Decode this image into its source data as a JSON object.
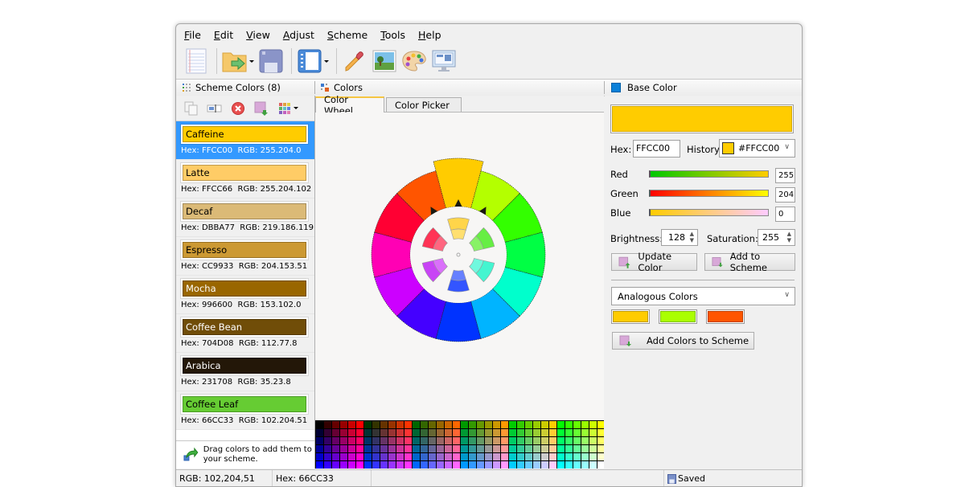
{
  "menu": {
    "items": [
      {
        "label": "File",
        "mnemonic": "F",
        "rest": "ile"
      },
      {
        "label": "Edit",
        "mnemonic": "E",
        "rest": "dit"
      },
      {
        "label": "View",
        "mnemonic": "V",
        "rest": "iew"
      },
      {
        "label": "Adjust",
        "mnemonic": "A",
        "rest": "djust"
      },
      {
        "label": "Scheme",
        "mnemonic": "S",
        "rest": "cheme"
      },
      {
        "label": "Tools",
        "mnemonic": "T",
        "rest": "ools"
      },
      {
        "label": "Help",
        "mnemonic": "H",
        "rest": "elp"
      }
    ]
  },
  "toolbar": {
    "buttons": [
      "new-document-icon",
      "open-folder-icon",
      "save-icon",
      "layout-panel-icon",
      "eyedropper-icon",
      "image-icon",
      "palette-icon",
      "screen-icon"
    ]
  },
  "panels": {
    "scheme_header": "Scheme Colors (8)",
    "colors_header": "Colors",
    "base_header": "Base Color"
  },
  "scheme": {
    "items": [
      {
        "name": "Caffeine",
        "hex": "FFCC00",
        "rgb": "255.204.0",
        "color": "#FFCC00",
        "text_color": "#000000",
        "selected": true
      },
      {
        "name": "Latte",
        "hex": "FFCC66",
        "rgb": "255.204.102",
        "color": "#FFCC66",
        "text_color": "#000000",
        "selected": false
      },
      {
        "name": "Decaf",
        "hex": "DBBA77",
        "rgb": "219.186.119",
        "color": "#DBBA77",
        "text_color": "#000000",
        "selected": false
      },
      {
        "name": "Espresso",
        "hex": "CC9933",
        "rgb": "204.153.51",
        "color": "#CC9933",
        "text_color": "#000000",
        "selected": false
      },
      {
        "name": "Mocha",
        "hex": "996600",
        "rgb": "153.102.0",
        "color": "#996600",
        "text_color": "#ffffff",
        "selected": false
      },
      {
        "name": "Coffee Bean",
        "hex": "704D08",
        "rgb": "112.77.8",
        "color": "#704D08",
        "text_color": "#ffffff",
        "selected": false
      },
      {
        "name": "Arabica",
        "hex": "231708",
        "rgb": "35.23.8",
        "color": "#231708",
        "text_color": "#ffffff",
        "selected": false
      },
      {
        "name": "Coffee Leaf",
        "hex": "66CC33",
        "rgb": "102.204.51",
        "color": "#66CC33",
        "text_color": "#000000",
        "selected": false
      }
    ],
    "hex_prefix": "Hex: ",
    "rgb_prefix": "RGB: ",
    "hint": "Drag colors to add them to your scheme."
  },
  "tabs": {
    "wheel": "Color Wheel",
    "picker": "Color Picker",
    "active": "wheel"
  },
  "wheel": {
    "outer_colors": [
      "#FFCC00",
      "#B4FF00",
      "#33FF00",
      "#00FF44",
      "#00FFCC",
      "#00B4FF",
      "#0033FF",
      "#4400FF",
      "#CC00FF",
      "#FF00B4",
      "#FF0033",
      "#FF5500"
    ],
    "inner_colors": [
      {
        "a": "#FFD54A",
        "b": "#FFDF70"
      },
      {
        "a": "#66EE44",
        "b": "#88F266"
      },
      {
        "a": "#44F5D0",
        "b": "#70F8DE"
      },
      {
        "a": "#3355FF",
        "b": "#6680FF"
      },
      {
        "a": "#C844F5",
        "b": "#DA70FA"
      },
      {
        "a": "#FF3355",
        "b": "#FF6680"
      }
    ]
  },
  "base": {
    "color": "#FFCC00",
    "hex_label": "Hex:",
    "hex_value": "FFCC00",
    "history_label": "History:",
    "history_value": "#FFCC00",
    "red_label": "Red",
    "green_label": "Green",
    "blue_label": "Blue",
    "red": 255,
    "green": 204,
    "blue": 0,
    "brightness_label": "Brightness:",
    "brightness": 128,
    "saturation_label": "Saturation:",
    "saturation": 255,
    "update_button": "Update Color",
    "add_button": "Add to Scheme",
    "harmony_mode": "Analogous Colors",
    "harmony_colors": [
      "#FFCC00",
      "#AAFF00",
      "#FF5500"
    ],
    "add_colors_button": "Add Colors to Scheme"
  },
  "status": {
    "rgb": "RGB: 102,204,51",
    "hex": "Hex: 66CC33",
    "saved": "Saved"
  }
}
